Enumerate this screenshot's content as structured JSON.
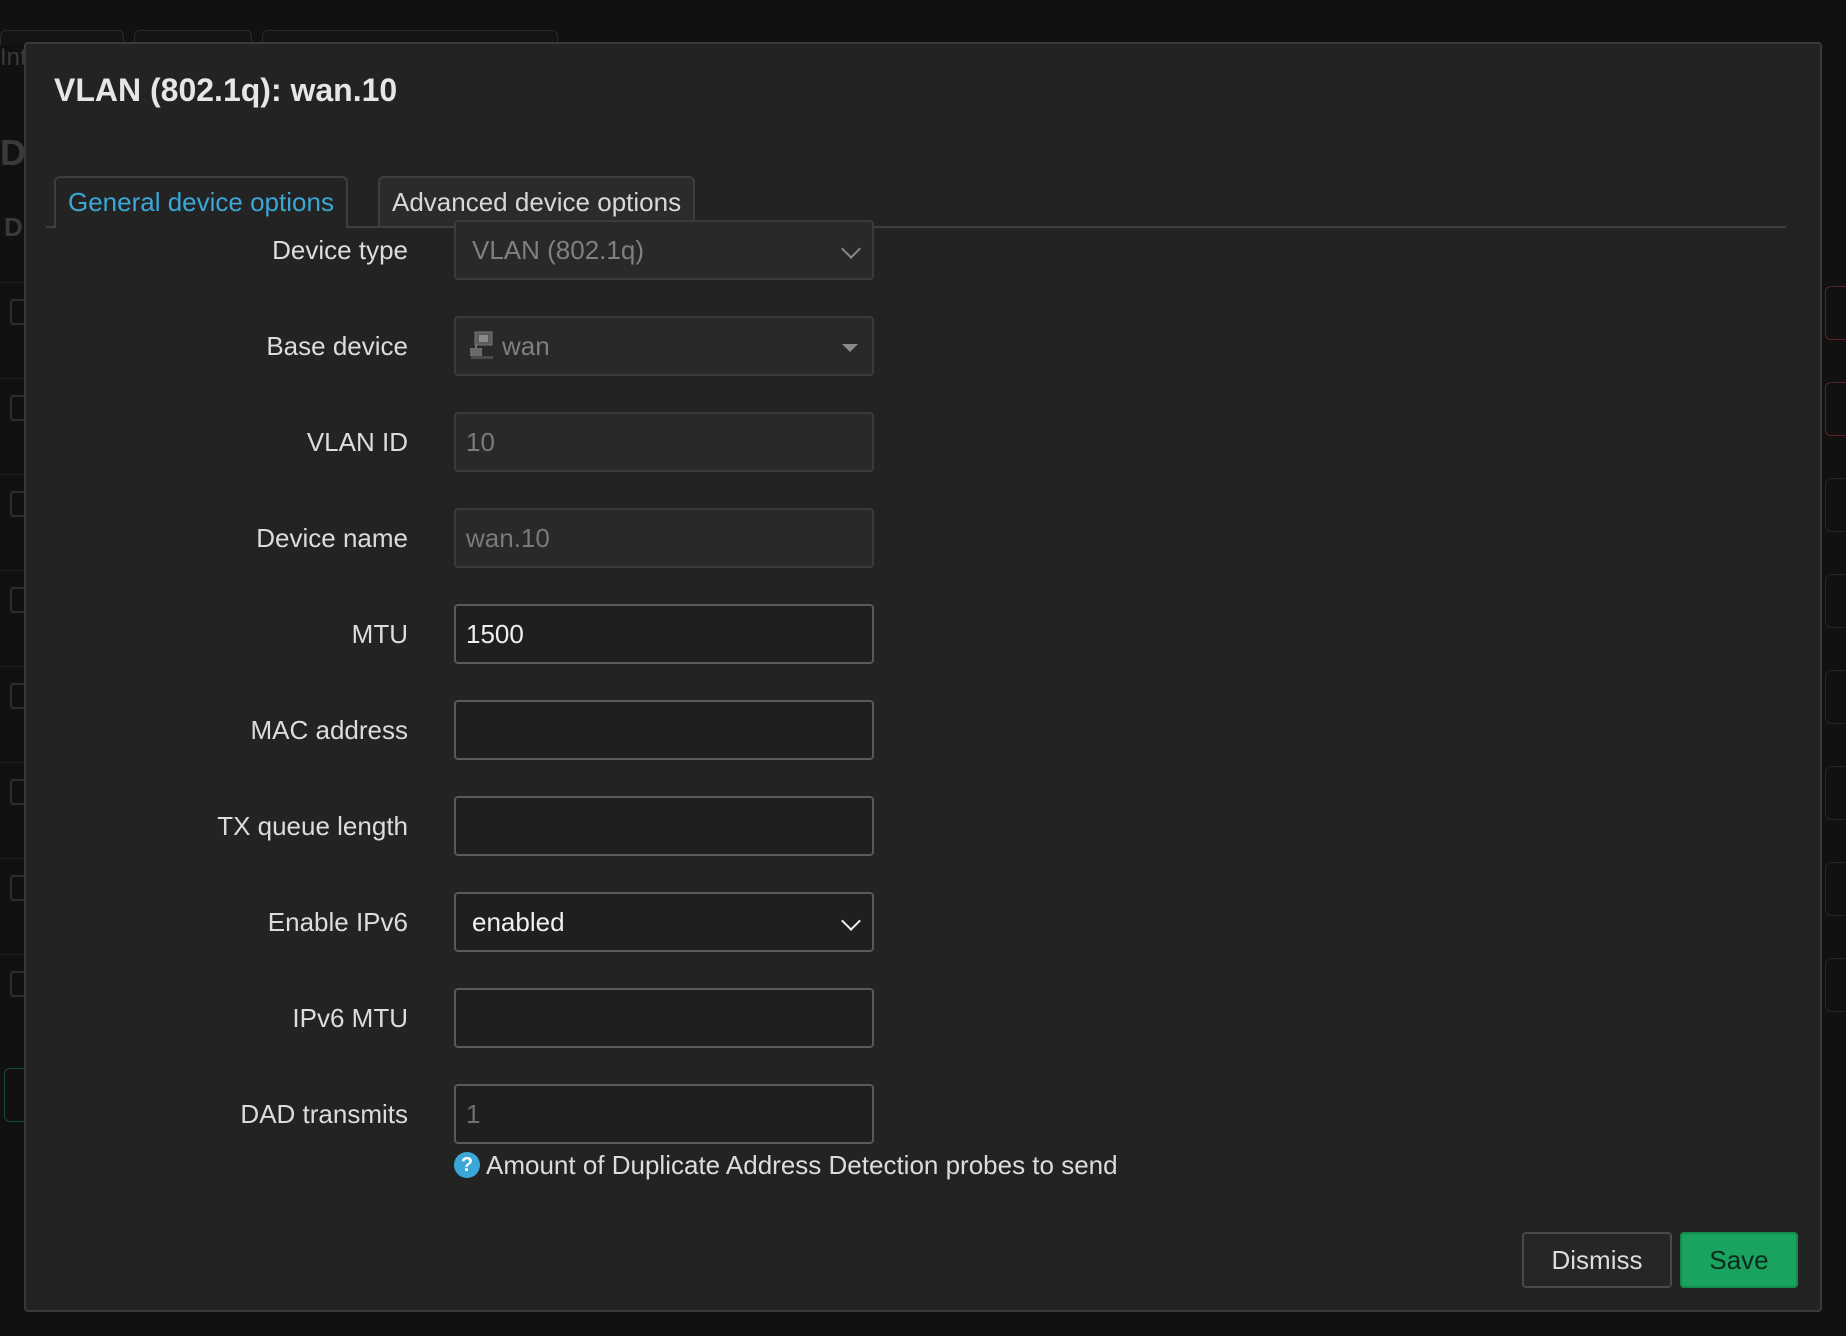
{
  "background": {
    "fragments": [
      "Int",
      "De",
      "D"
    ]
  },
  "modal": {
    "title": "VLAN (802.1q): wan.10",
    "tabs": [
      {
        "label": "General device options",
        "active": true
      },
      {
        "label": "Advanced device options",
        "active": false
      }
    ],
    "fields": {
      "device_type": {
        "label": "Device type",
        "value": "VLAN (802.1q)",
        "disabled": true
      },
      "base_device": {
        "label": "Base device",
        "value": "wan",
        "icon": "ethernet-port-icon",
        "disabled": true
      },
      "vlan_id": {
        "label": "VLAN ID",
        "placeholder": "10",
        "disabled": true
      },
      "device_name": {
        "label": "Device name",
        "placeholder": "wan.10",
        "disabled": true
      },
      "mtu": {
        "label": "MTU",
        "value": "1500"
      },
      "mac_address": {
        "label": "MAC address",
        "value": ""
      },
      "tx_queue_length": {
        "label": "TX queue length",
        "value": ""
      },
      "enable_ipv6": {
        "label": "Enable IPv6",
        "value": "enabled"
      },
      "ipv6_mtu": {
        "label": "IPv6 MTU",
        "value": ""
      },
      "dad_transmits": {
        "label": "DAD transmits",
        "placeholder": "1",
        "help": "Amount of Duplicate Address Detection probes to send",
        "help_icon": "?"
      }
    },
    "buttons": {
      "dismiss": "Dismiss",
      "save": "Save"
    }
  },
  "colors": {
    "accent": "#3aa7d6",
    "save": "#1aa25f",
    "modal_bg": "#232323"
  }
}
